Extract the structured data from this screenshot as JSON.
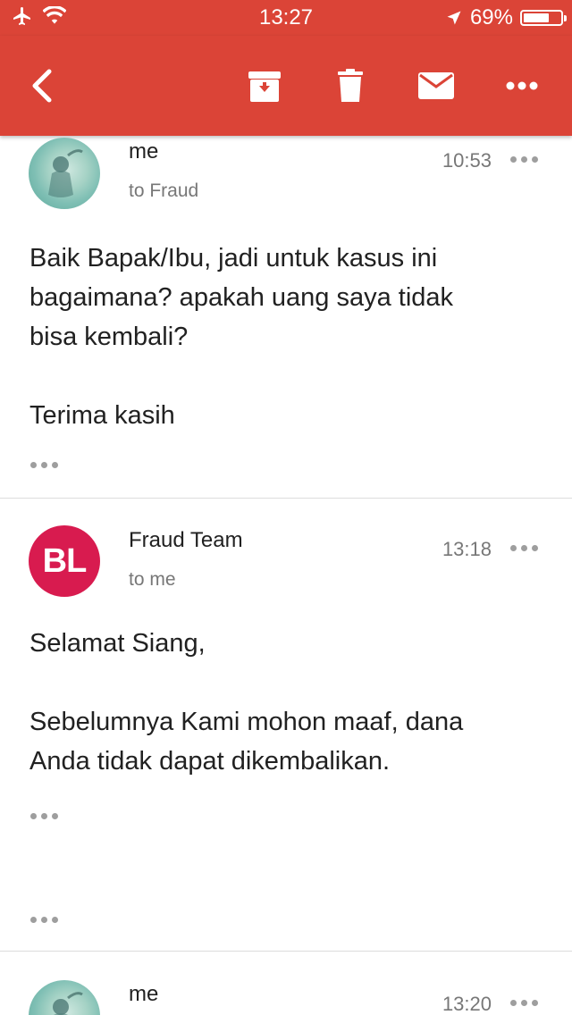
{
  "status_bar": {
    "time": "13:27",
    "battery_percent": "69%",
    "battery_level": 0.69
  },
  "toolbar": {
    "back_icon": "chevron-left-icon",
    "archive_icon": "archive-icon",
    "delete_icon": "trash-icon",
    "mail_icon": "mail-icon",
    "more_icon": "more-horiz-icon"
  },
  "colors": {
    "toolbar": "#db4437",
    "avatar_bl": "#d81b4f"
  },
  "messages": [
    {
      "sender": "me",
      "recipient": "to Fraud",
      "time": "10:53",
      "lines": [
        "Baik Bapak/Ibu, jadi untuk kasus ini",
        "bagaimana? apakah uang saya tidak",
        "bisa kembali?",
        "",
        "Terima kasih"
      ]
    },
    {
      "sender": "Fraud Team",
      "avatar_text": "BL",
      "recipient": "to me",
      "time": "13:18",
      "lines": [
        "Selamat Siang,",
        "",
        "Sebelumnya Kami mohon maaf, dana",
        "Anda tidak dapat dikembalikan."
      ]
    },
    {
      "sender": "me",
      "time": "13:20"
    }
  ]
}
